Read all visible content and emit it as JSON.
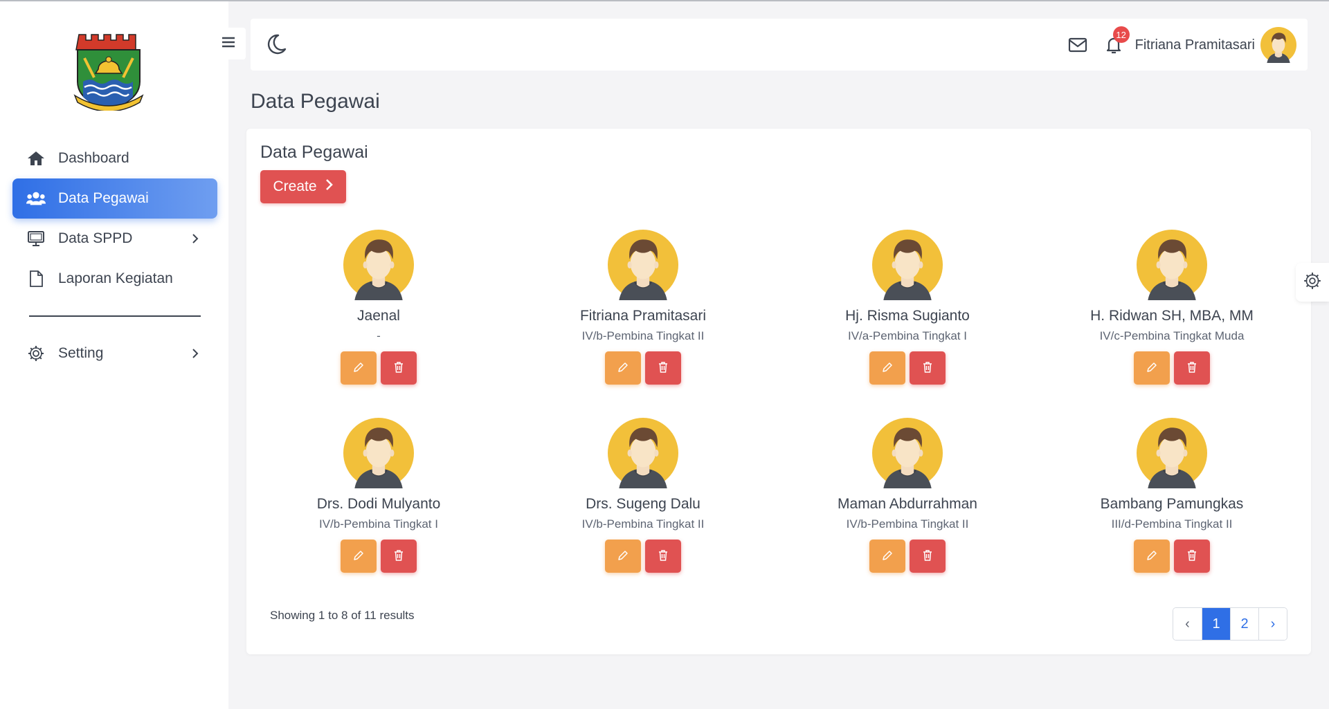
{
  "sidebar": {
    "items": [
      {
        "label": "Dashboard",
        "icon": "home-icon"
      },
      {
        "label": "Data Pegawai",
        "icon": "users-icon"
      },
      {
        "label": "Data SPPD",
        "icon": "monitor-icon"
      },
      {
        "label": "Laporan Kegiatan",
        "icon": "file-icon"
      },
      {
        "label": "Setting",
        "icon": "gear-icon"
      }
    ],
    "active_color": "#2f6fe6"
  },
  "topbar": {
    "notification_count": "12",
    "user_name": "Fitriana Pramitasari"
  },
  "page": {
    "title": "Data Pegawai"
  },
  "card": {
    "title": "Data Pegawai",
    "create_label": "Create"
  },
  "employees": [
    {
      "name": "Jaenal",
      "rank": "-"
    },
    {
      "name": "Fitriana Pramitasari",
      "rank": "IV/b-Pembina Tingkat II"
    },
    {
      "name": "Hj. Risma Sugianto",
      "rank": "IV/a-Pembina Tingkat I"
    },
    {
      "name": "H. Ridwan SH, MBA, MM",
      "rank": "IV/c-Pembina Tingkat Muda"
    },
    {
      "name": "Drs. Dodi Mulyanto",
      "rank": "IV/b-Pembina Tingkat I"
    },
    {
      "name": "Drs. Sugeng Dalu",
      "rank": "IV/b-Pembina Tingkat II"
    },
    {
      "name": "Maman Abdurrahman",
      "rank": "IV/b-Pembina Tingkat II"
    },
    {
      "name": "Bambang Pamungkas",
      "rank": "III/d-Pembina Tingkat II"
    }
  ],
  "pagination": {
    "summary": "Showing 1 to 8 of 11 results",
    "prev": "‹",
    "pages": [
      "1",
      "2"
    ],
    "current": "1",
    "next": "›"
  }
}
